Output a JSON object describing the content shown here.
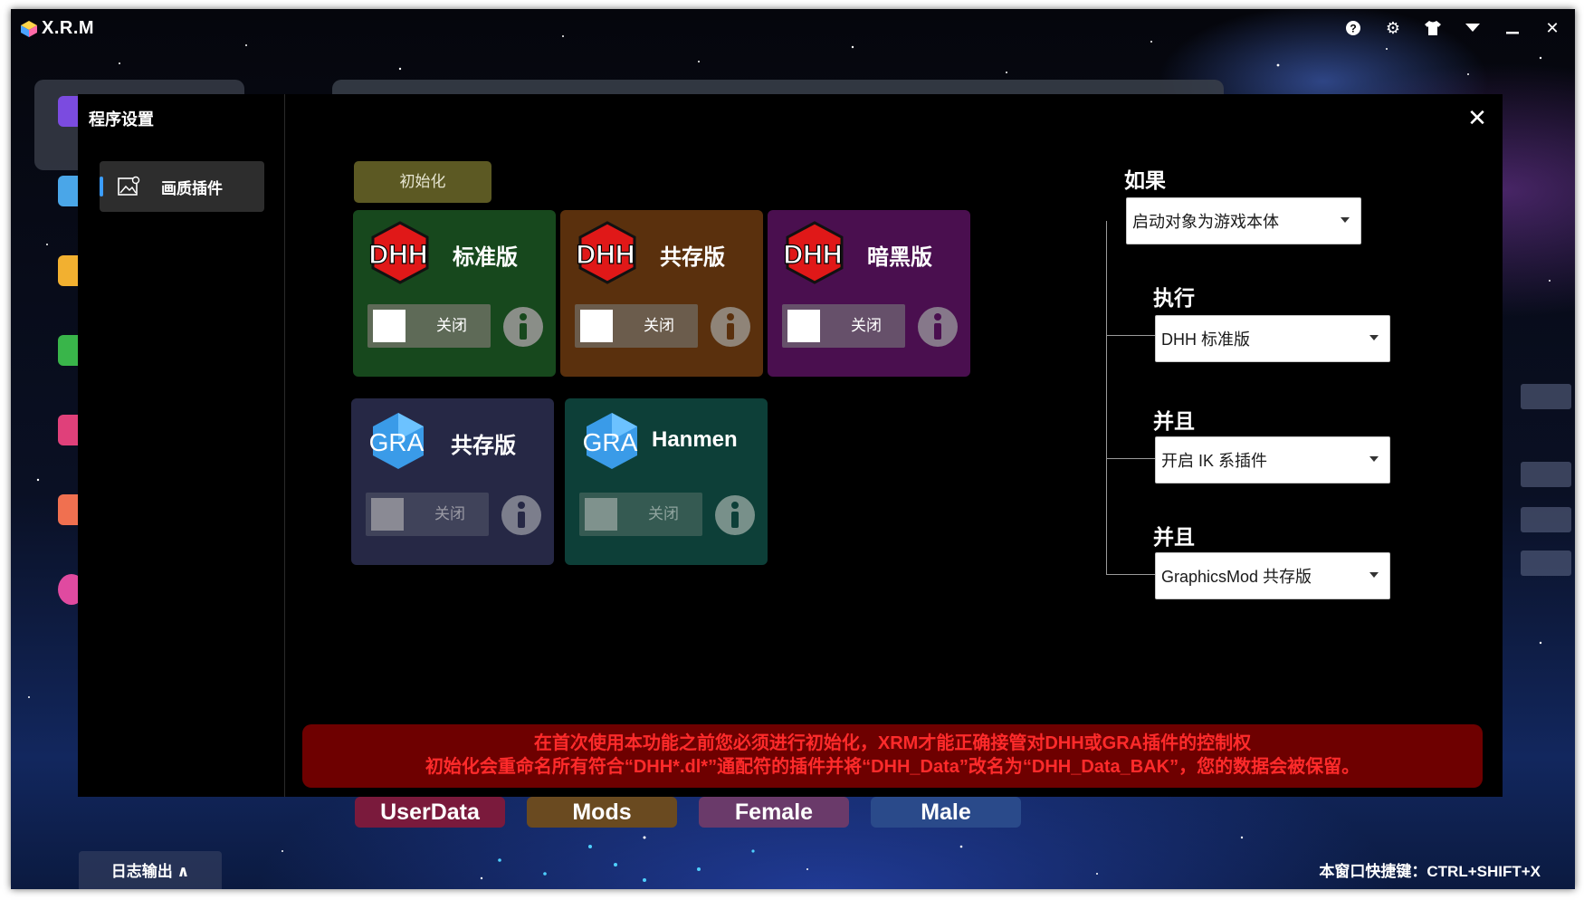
{
  "app": {
    "title": "X.R.M",
    "controls": [
      "help-icon",
      "gear-icon",
      "shirt-icon",
      "dropdown-icon",
      "minimize-icon",
      "close-icon"
    ]
  },
  "background": {
    "bottom_tabs": [
      {
        "label": "UserData",
        "color": "#7a1a3c"
      },
      {
        "label": "Mods",
        "color": "#6a4a20"
      },
      {
        "label": "Female",
        "color": "#6a3a6a"
      },
      {
        "label": "Male",
        "color": "#2a4a8a"
      }
    ],
    "log_button": "日志输出 ∧",
    "hotkey": "本窗口快捷键：CTRL+SHIFT+X"
  },
  "dialog": {
    "title": "程序设置",
    "sidebar": {
      "items": [
        {
          "label": "画质插件",
          "icon": "image-settings-icon",
          "active": true
        }
      ]
    },
    "init_button": "初始化",
    "plugins": [
      {
        "logo": "DHH",
        "name": "标准版",
        "toggle": "关闭",
        "bg": "#17481d",
        "toggle_bg": "#5e6a57"
      },
      {
        "logo": "DHH",
        "name": "共存版",
        "toggle": "关闭",
        "bg": "#5a300d",
        "toggle_bg": "#6b5c4c"
      },
      {
        "logo": "DHH",
        "name": "暗黑版",
        "toggle": "关闭",
        "bg": "#4a0f4f",
        "toggle_bg": "#66506a"
      },
      {
        "logo": "GRA",
        "name": "共存版",
        "toggle": "关闭",
        "bg": "#262845",
        "toggle_bg": "#40435a"
      },
      {
        "logo": "GRA",
        "name": "Hanmen",
        "toggle": "关闭",
        "bg": "#0d3f38",
        "toggle_bg": "#355a52"
      }
    ],
    "conditions": [
      {
        "label": "如果",
        "value": "启动对象为游戏本体"
      },
      {
        "label": "执行",
        "value": "DHH 标准版"
      },
      {
        "label": "并且",
        "value": "开启 IK 系插件"
      },
      {
        "label": "并且",
        "value": "GraphicsMod 共存版"
      }
    ],
    "warning": {
      "line1": "在首次使用本功能之前您必须进行初始化，XRM才能正确接管对DHH或GRA插件的控制权",
      "line2": "初始化会重命名所有符合“DHH*.dl*”通配符的插件并将“DHH_Data”改名为“DHH_Data_BAK”，您的数据会被保留。"
    }
  }
}
